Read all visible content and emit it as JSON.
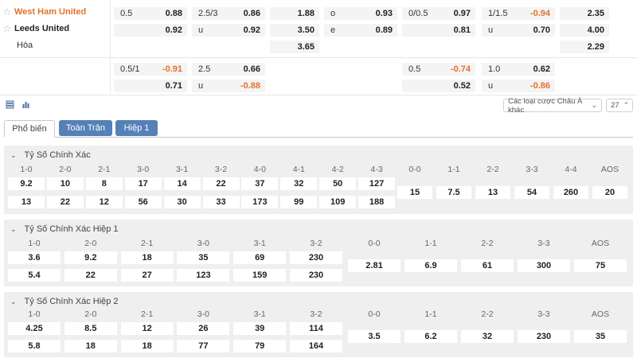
{
  "match": {
    "home_team": "West Ham United",
    "away_team": "Leeds United",
    "draw_label": "Hòa",
    "star_icon": "star-outline-icon"
  },
  "odds": {
    "row1": [
      {
        "l": "0.5",
        "r": "0.88",
        "neg": false
      },
      {
        "l": "2.5/3",
        "r": "0.86",
        "neg": false
      },
      {
        "l": "",
        "r": "1.88",
        "neg": false
      },
      {
        "l": "o",
        "r": "0.93",
        "neg": false
      },
      {
        "l": "0/0.5",
        "r": "0.97",
        "neg": false
      },
      {
        "l": "1/1.5",
        "r": "-0.94",
        "neg": true
      },
      {
        "l": "",
        "r": "2.35",
        "neg": false
      }
    ],
    "row2": [
      {
        "l": "",
        "r": "0.92",
        "neg": false
      },
      {
        "l": "u",
        "r": "0.92",
        "neg": false
      },
      {
        "l": "",
        "r": "3.50",
        "neg": false
      },
      {
        "l": "e",
        "r": "0.89",
        "neg": false
      },
      {
        "l": "",
        "r": "0.81",
        "neg": false
      },
      {
        "l": "u",
        "r": "0.70",
        "neg": false
      },
      {
        "l": "",
        "r": "4.00",
        "neg": false
      }
    ],
    "row3": [
      {
        "l": "",
        "r": "3.65",
        "neg": false
      },
      {
        "l": "",
        "r": "2.29",
        "neg": false
      }
    ],
    "row4": [
      {
        "l": "0.5/1",
        "r": "-0.91",
        "neg": true
      },
      {
        "l": "2.5",
        "r": "0.66",
        "neg": false
      },
      {
        "l": "0.5",
        "r": "-0.74",
        "neg": true
      },
      {
        "l": "1.0",
        "r": "0.62",
        "neg": false
      }
    ],
    "row5": [
      {
        "l": "",
        "r": "0.71",
        "neg": false
      },
      {
        "l": "u",
        "r": "-0.88",
        "neg": true
      },
      {
        "l": "",
        "r": "0.52",
        "neg": false
      },
      {
        "l": "u",
        "r": "-0.86",
        "neg": true
      }
    ]
  },
  "toolbar": {
    "list_icon": "list-icon",
    "chart_icon": "bar-chart-icon",
    "market_dropdown": "Các loại cược Châu Á khác",
    "count_dropdown": "27"
  },
  "tabs": [
    {
      "label": "Phổ biến",
      "active": true
    },
    {
      "label": "Toàn Trận",
      "active": false
    },
    {
      "label": "Hiệp 1",
      "active": false
    }
  ],
  "sections": [
    {
      "title": "Tỷ Số Chính Xác",
      "home_headers": [
        "1-0",
        "2-0",
        "2-1",
        "3-0",
        "3-1",
        "3-2",
        "4-0",
        "4-1",
        "4-2",
        "4-3"
      ],
      "home_row1": [
        "9.2",
        "10",
        "8",
        "17",
        "14",
        "22",
        "37",
        "32",
        "50",
        "127"
      ],
      "home_row2": [
        "13",
        "22",
        "12",
        "56",
        "30",
        "33",
        "173",
        "99",
        "109",
        "188"
      ],
      "draw_headers": [
        "0-0",
        "1-1",
        "2-2",
        "3-3",
        "4-4",
        "AOS"
      ],
      "draw_values": [
        "15",
        "7.5",
        "13",
        "54",
        "260",
        "20"
      ]
    },
    {
      "title": "Tỷ Số Chính Xác Hiệp 1",
      "home_headers": [
        "1-0",
        "2-0",
        "2-1",
        "3-0",
        "3-1",
        "3-2"
      ],
      "home_row1": [
        "3.6",
        "9.2",
        "18",
        "35",
        "69",
        "230"
      ],
      "home_row2": [
        "5.4",
        "22",
        "27",
        "123",
        "159",
        "230"
      ],
      "draw_headers": [
        "0-0",
        "1-1",
        "2-2",
        "3-3",
        "AOS"
      ],
      "draw_values": [
        "2.81",
        "6.9",
        "61",
        "300",
        "75"
      ]
    },
    {
      "title": "Tỷ Số Chính Xác Hiệp 2",
      "home_headers": [
        "1-0",
        "2-0",
        "2-1",
        "3-0",
        "3-1",
        "3-2"
      ],
      "home_row1": [
        "4.25",
        "8.5",
        "12",
        "26",
        "39",
        "114"
      ],
      "home_row2": [
        "5.8",
        "18",
        "18",
        "77",
        "79",
        "164"
      ],
      "draw_headers": [
        "0-0",
        "1-1",
        "2-2",
        "3-3",
        "AOS"
      ],
      "draw_values": [
        "3.5",
        "6.2",
        "32",
        "230",
        "35"
      ]
    }
  ]
}
